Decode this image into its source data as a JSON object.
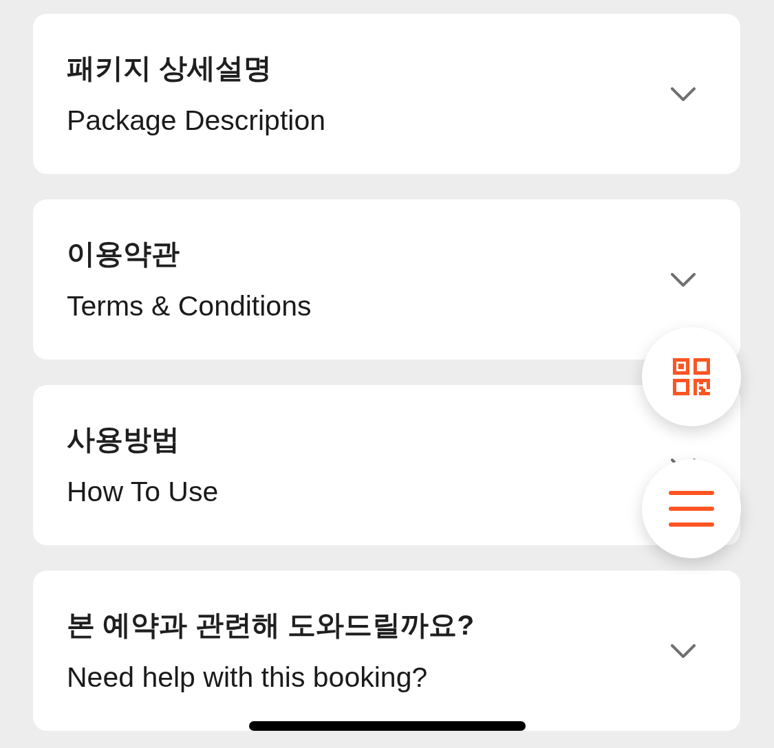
{
  "sections": [
    {
      "title": "패키지 상세설명",
      "subtitle": "Package Description",
      "expanded": false
    },
    {
      "title": "이용약관",
      "subtitle": "Terms & Conditions",
      "expanded": false
    },
    {
      "title": "사용방법",
      "subtitle": "How To Use",
      "expanded": false
    },
    {
      "title": "본 예약과 관련해 도와드릴까요?",
      "subtitle": "Need help with this booking?",
      "expanded": false
    }
  ]
}
